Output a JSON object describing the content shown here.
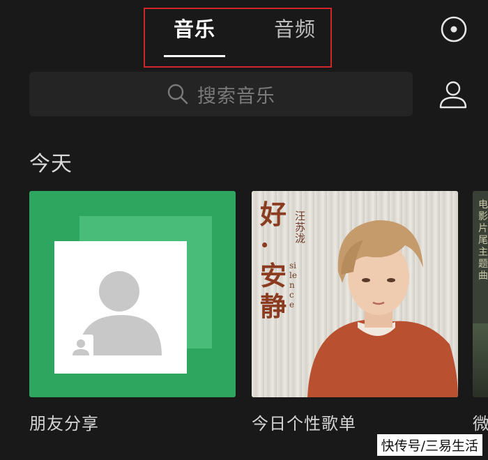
{
  "tabs": {
    "music": "音乐",
    "audio": "音频"
  },
  "search": {
    "placeholder": "搜索音乐"
  },
  "section": {
    "title": "今天"
  },
  "cards": [
    {
      "label": "朋友分享"
    },
    {
      "label": "今日个性歌单"
    },
    {
      "label": "微"
    }
  ],
  "album": {
    "title": "好·安静",
    "artist": "汪苏泷",
    "subtitle": "silence"
  },
  "third_card_text": "电影片尾主题曲",
  "watermark": "快传号/三易生活",
  "colors": {
    "background": "#191919",
    "accent_green": "#2ea65f",
    "highlight_red": "#d0262a"
  },
  "icons": [
    "radio-icon",
    "search-icon",
    "profile-icon",
    "friend-avatar-icon"
  ]
}
